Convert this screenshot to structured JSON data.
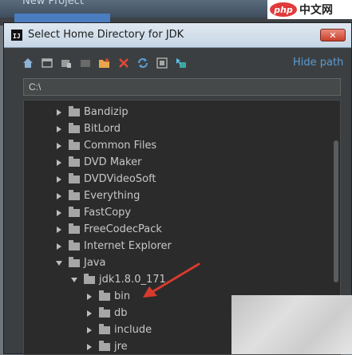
{
  "background_window": {
    "title": "New Project"
  },
  "watermark": {
    "logo": "php",
    "text": "中文网"
  },
  "dialog": {
    "title": "Select Home Directory for JDK",
    "close_label": "✕",
    "toolbar": {
      "icons": [
        "home-icon",
        "desktop-icon",
        "project-icon",
        "module-icon",
        "new-folder-icon",
        "delete-icon",
        "refresh-icon",
        "show-hidden-icon",
        "drag-drop-icon"
      ],
      "hide_path_label": "Hide path"
    },
    "path_value": "C:\\",
    "tree": [
      {
        "label": "Bandizip",
        "expanded": false,
        "depth": 0
      },
      {
        "label": "BitLord",
        "expanded": false,
        "depth": 0
      },
      {
        "label": "Common Files",
        "expanded": false,
        "depth": 0
      },
      {
        "label": "DVD Maker",
        "expanded": false,
        "depth": 0
      },
      {
        "label": "DVDVideoSoft",
        "expanded": false,
        "depth": 0
      },
      {
        "label": "Everything",
        "expanded": false,
        "depth": 0
      },
      {
        "label": "FastCopy",
        "expanded": false,
        "depth": 0
      },
      {
        "label": "FreeCodecPack",
        "expanded": false,
        "depth": 0
      },
      {
        "label": "Internet Explorer",
        "expanded": false,
        "depth": 0
      },
      {
        "label": "Java",
        "expanded": true,
        "depth": 0
      },
      {
        "label": "jdk1.8.0_171",
        "expanded": true,
        "depth": 1
      },
      {
        "label": "bin",
        "expanded": false,
        "depth": 2
      },
      {
        "label": "db",
        "expanded": false,
        "depth": 2
      },
      {
        "label": "include",
        "expanded": false,
        "depth": 2
      },
      {
        "label": "jre",
        "expanded": false,
        "depth": 2
      }
    ]
  },
  "colors": {
    "accent_link": "#5b9bd5",
    "annotation_arrow": "#d83a2e",
    "tree_bg": "#2b2b2b"
  }
}
